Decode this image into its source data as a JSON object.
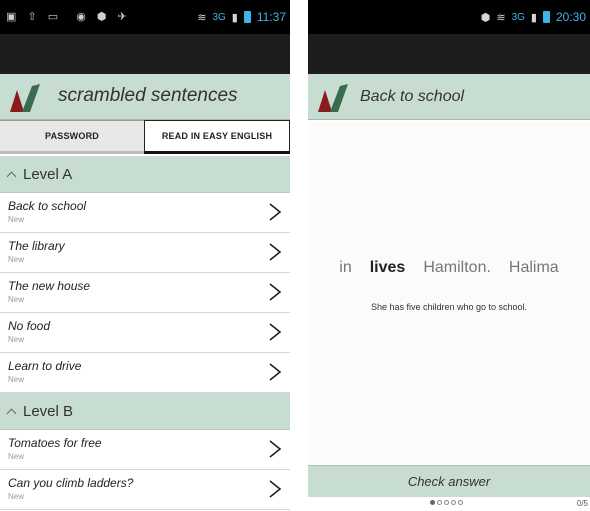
{
  "left": {
    "status": {
      "clock": "11:37",
      "network": "3G"
    },
    "app_title": "scrambled sentences",
    "tabs": [
      {
        "label": "PASSWORD",
        "active": false
      },
      {
        "label": "READ IN EASY ENGLISH",
        "active": true
      }
    ],
    "sections": [
      {
        "title": "Level A",
        "items": [
          {
            "title": "Back to school",
            "status": "New"
          },
          {
            "title": "The library",
            "status": "New"
          },
          {
            "title": "The new house",
            "status": "New"
          },
          {
            "title": "No food",
            "status": "New"
          },
          {
            "title": "Learn to drive",
            "status": "New"
          }
        ]
      },
      {
        "title": "Level B",
        "items": [
          {
            "title": "Tomatoes for free",
            "status": "New"
          },
          {
            "title": "Can you climb ladders?",
            "status": "New"
          }
        ]
      }
    ]
  },
  "right": {
    "status": {
      "clock": "20:30",
      "network": "3G"
    },
    "title": "Back to school",
    "words": [
      {
        "text": "in",
        "selected": false
      },
      {
        "text": "lives",
        "selected": true
      },
      {
        "text": "Hamilton.",
        "selected": false
      },
      {
        "text": "Halima",
        "selected": false
      }
    ],
    "hint": "She has five children who go to school.",
    "check_label": "Check answer",
    "progress": {
      "current": 0,
      "total": 5,
      "counter": "0/5"
    }
  },
  "colors": {
    "header_green": "#c7ddd1",
    "logo_red": "#8b1a1a",
    "logo_green": "#3a6b4f",
    "status_blue": "#3fb4e8"
  }
}
